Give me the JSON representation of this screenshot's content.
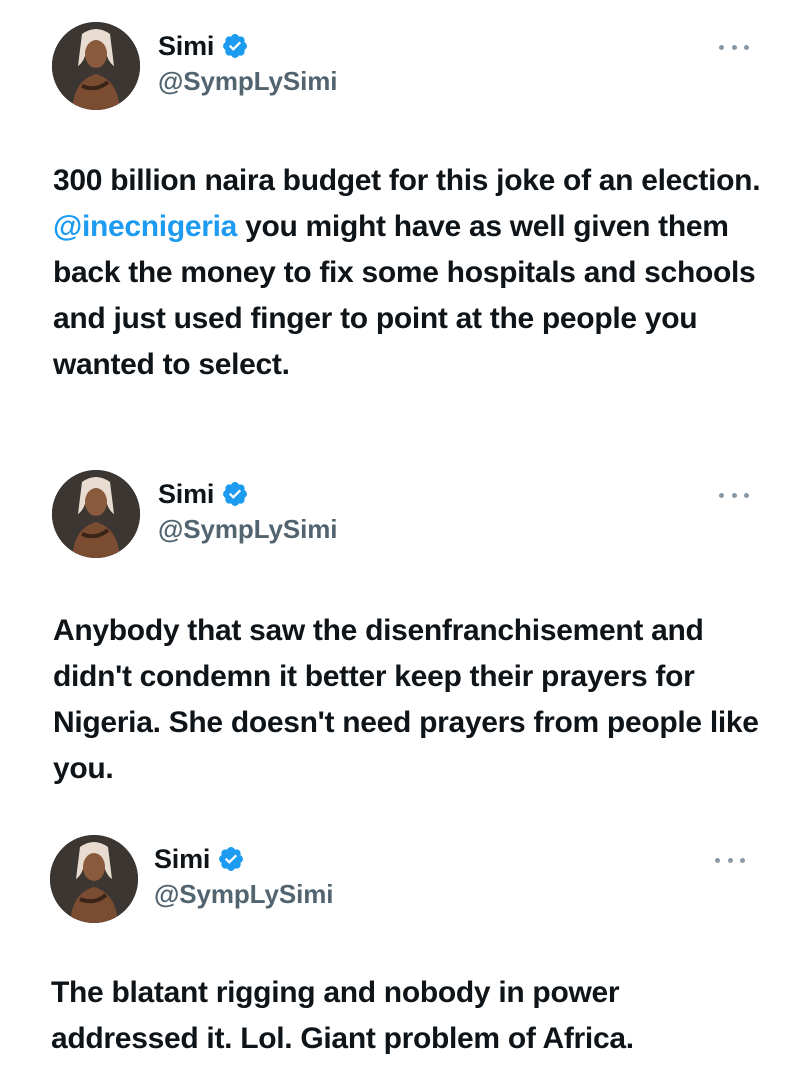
{
  "tweets": [
    {
      "author": {
        "name": "Simi",
        "handle": "@SympLySimi",
        "verified": true
      },
      "text_before": "300 billion naira budget for this joke of an election. ",
      "mention": "@inecnigeria",
      "text_after": " you might have as well given them back the money to fix some hospitals and schools and just used finger to point at the people you wanted to select."
    },
    {
      "author": {
        "name": "Simi",
        "handle": "@SympLySimi",
        "verified": true
      },
      "text": "Anybody that saw the disenfranchisement and didn't condemn it better keep their prayers for Nigeria. She doesn't need prayers from people like you."
    },
    {
      "author": {
        "name": "Simi",
        "handle": "@SympLySimi",
        "verified": true
      },
      "text": "The blatant rigging and nobody in power addressed it. Lol. Giant problem of Africa."
    }
  ],
  "icons": {
    "verified": "verified-badge-icon",
    "more": "more-options-icon",
    "avatar": "profile-avatar"
  },
  "colors": {
    "text": "#0f1419",
    "handle": "#536471",
    "mention": "#1d9bf0",
    "verified": "#1d9bf0",
    "more_dots": "#8b98a5",
    "background": "#ffffff"
  }
}
